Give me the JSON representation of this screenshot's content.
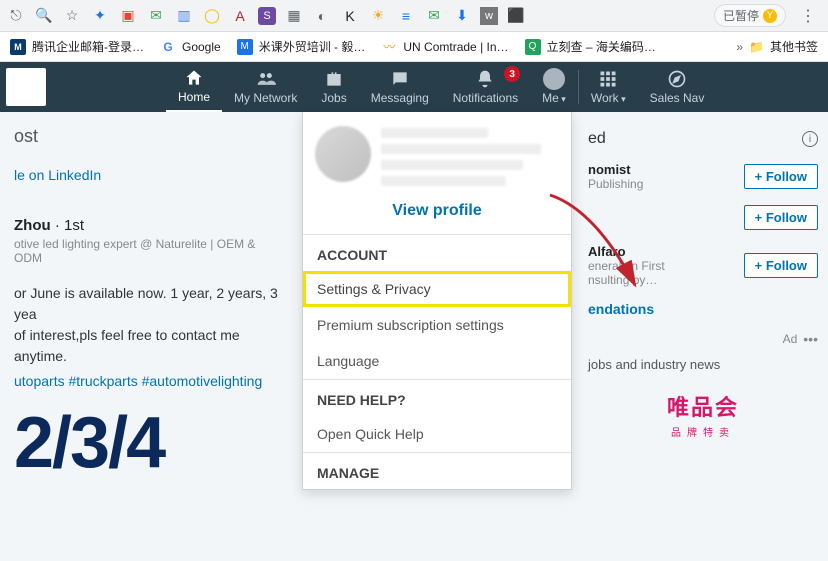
{
  "chrome": {
    "pause_label": "已暂停",
    "avatar_letter": "Y",
    "bookmarks": [
      {
        "label": "腾讯企业邮箱-登录…",
        "fav_class": "fav-tx",
        "fav_text": "M"
      },
      {
        "label": "Google",
        "fav_class": "fav-g",
        "fav_text": "G"
      },
      {
        "label": "米课外贸培训 - 毅…",
        "fav_class": "fav-m",
        "fav_text": "M"
      },
      {
        "label": "UN Comtrade | In…",
        "fav_class": "fav-un",
        "fav_text": "〰"
      },
      {
        "label": "立刻查 – 海关编码…",
        "fav_class": "fav-lk",
        "fav_text": "Q"
      }
    ],
    "other_bookmarks": "其他书签"
  },
  "nav": {
    "home": "Home",
    "network": "My Network",
    "jobs": "Jobs",
    "messaging": "Messaging",
    "notifications": "Notifications",
    "notif_count": "3",
    "me": "Me",
    "work": "Work",
    "sales": "Sales Nav"
  },
  "feed": {
    "start_post": "ost",
    "article_link": "le on LinkedIn",
    "author_name": "Zhou",
    "author_degree": "1st",
    "author_sub": "otive led lighting expert @ Naturelite | OEM & ODM",
    "body_l1": "or June is available now. 1 year, 2 years, 3 yea",
    "body_l2": "of interest,pls feel free to contact me anytime.",
    "tags": "utoparts  #truckparts  #automotivelighting",
    "big": "2/3/4"
  },
  "dropdown": {
    "view_profile": "View profile",
    "section_account": "ACCOUNT",
    "settings_privacy": "Settings & Privacy",
    "premium": "Premium subscription settings",
    "language": "Language",
    "section_help": "NEED HELP?",
    "open_help": "Open Quick Help",
    "section_manage": "MANAGE"
  },
  "rail": {
    "header": "ed",
    "sug1_title": "nomist",
    "sug1_sub": "Publishing",
    "sug2_title": "",
    "sug2_sub": "",
    "sug3_title": "Alfaro",
    "sug3_sub_a": "eneral en First",
    "sug3_sub_b": "nsulting by…",
    "follow": "+ Follow",
    "more": "endations",
    "ad_label": "Ad",
    "news": "jobs and industry news",
    "brand_zh": "唯品会",
    "brand_sm": "品牌特卖"
  }
}
